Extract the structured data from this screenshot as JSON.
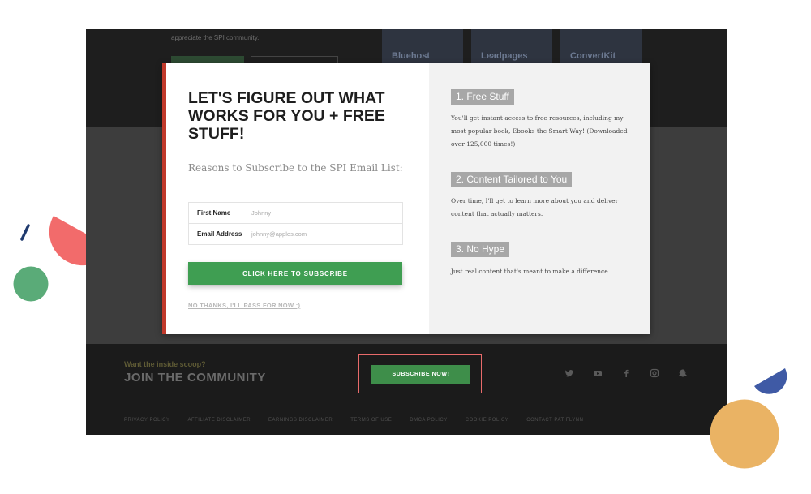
{
  "background_page": {
    "top_text": "appreciate the SPI community.",
    "cards": [
      "Bluehost",
      "Leadpages",
      "ConvertKit"
    ]
  },
  "modal": {
    "headline": "LET'S FIGURE OUT WHAT WORKS FOR YOU + FREE STUFF!",
    "subheading": "Reasons to Subscribe to the SPI Email List:",
    "form": {
      "first_name_label": "First Name",
      "first_name_placeholder": "Johnny",
      "email_label": "Email Address",
      "email_placeholder": "johnny@apples.com"
    },
    "subscribe_button": "CLICK HERE TO SUBSCRIBE",
    "decline_link": "NO THANKS, I'LL PASS FOR NOW :)",
    "benefits": [
      {
        "title": "1. Free Stuff",
        "text": "You'll get instant access to free resources, including my most popular book, Ebooks the Smart Way! (Downloaded over 125,000 times!)"
      },
      {
        "title": "2. Content Tailored to You",
        "text": "Over time, I'll get to learn more about you and deliver content that actually matters."
      },
      {
        "title": "3. No Hype",
        "text": "Just real content that's meant to make a difference."
      }
    ]
  },
  "footer": {
    "pre_title": "Want the inside scoop?",
    "title": "JOIN THE COMMUNITY",
    "subscribe_now_button": "SUBSCRIBE NOW!",
    "social_icons": [
      "twitter-icon",
      "youtube-icon",
      "facebook-icon",
      "instagram-icon",
      "snapchat-icon"
    ],
    "links": [
      "PRIVACY POLICY",
      "AFFILIATE DISCLAIMER",
      "EARNINGS DISCLAIMER",
      "TERMS OF USE",
      "DMCA POLICY",
      "COOKIE POLICY",
      "CONTACT PAT FLYNN"
    ]
  },
  "colors": {
    "accent_green": "#3f9e52",
    "modal_accent_red": "#c0392b",
    "highlight_border": "#e96b6b",
    "decor_coral": "#f26b6b",
    "decor_green": "#5aab78",
    "decor_navy": "#1f3a6e",
    "decor_blue": "#3f5aa5",
    "decor_orange": "#eab364"
  }
}
